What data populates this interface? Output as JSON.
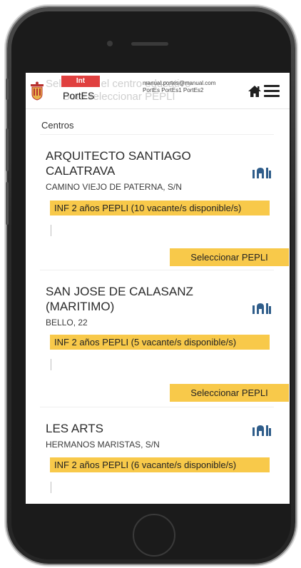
{
  "header": {
    "badge": "Int",
    "app_name": "PortES",
    "ghost_line1": "Seleccione el centro educativo",
    "ghost_line2": "Botó seleccionar PEPLI",
    "email": "manual.portes@manual.com",
    "user_roles": "PortEs PortEs1 PortEs2"
  },
  "section_label": "Centros",
  "centers": [
    {
      "title": "ARQUITECTO SANTIAGO CALATRAVA",
      "address": "CAMINO VIEJO DE PATERNA, S/N",
      "vacancy": "INF 2 años PEPLI (10 vacante/s disponible/s)",
      "button": "Seleccionar PEPLI"
    },
    {
      "title": "SAN JOSE DE CALASANZ (MARITIMO)",
      "address": "BELLO, 22",
      "vacancy": "INF 2 años PEPLI (5 vacante/s disponible/s)",
      "button": "Seleccionar PEPLI"
    },
    {
      "title": "LES ARTS",
      "address": "HERMANOS MARISTAS, S/N",
      "vacancy": "INF 2 años PEPLI (6 vacante/s disponible/s)"
    }
  ],
  "icons": {
    "logo": "institution-logo-icon",
    "home": "home-icon",
    "menu": "hamburger-menu-icon",
    "building": "building-icon"
  },
  "colors": {
    "badge": "#e0403f",
    "highlight": "#f8c94a",
    "building_icon": "#2f5d8a"
  }
}
